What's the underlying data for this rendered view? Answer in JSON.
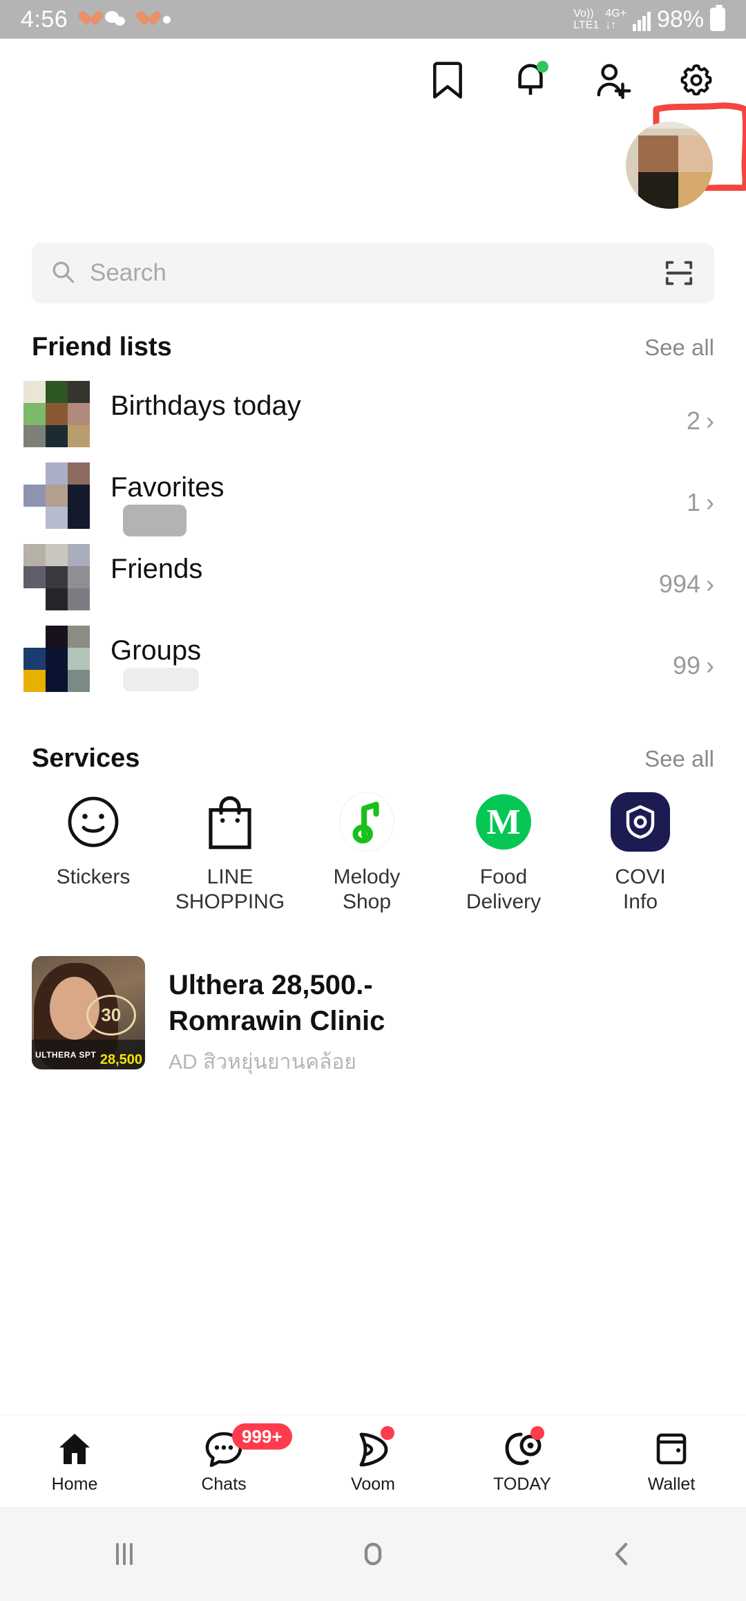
{
  "status_bar": {
    "time": "4:56",
    "icons": [
      "heart-icon",
      "wechat-icon",
      "heart-icon",
      "dot-icon"
    ],
    "volte": "Vo))",
    "network_label": "LTE1",
    "network_type": "4G+",
    "data_arrows": "↓↑",
    "battery_percent": "98%",
    "background": "#b4b4b4"
  },
  "header": {
    "icons": [
      {
        "name": "bookmark-icon",
        "label": "Keep"
      },
      {
        "name": "bell-icon",
        "label": "Notifications",
        "has_dot": true,
        "dot_color": "#30c45e"
      },
      {
        "name": "add-friend-icon",
        "label": "Add friends"
      },
      {
        "name": "gear-icon",
        "label": "Settings",
        "annotated": true
      }
    ],
    "annotation_color": "#f4453f"
  },
  "search": {
    "placeholder": "Search",
    "value": "",
    "scan_icon": "qr-scan-icon"
  },
  "friend_lists": {
    "title": "Friend lists",
    "see_all": "See all",
    "rows": [
      {
        "label": "Birthdays today",
        "count": "2",
        "chevron": "›"
      },
      {
        "label": "Favorites",
        "count": "1",
        "chevron": "›"
      },
      {
        "label": "Friends",
        "count": "994",
        "chevron": "›"
      },
      {
        "label": "Groups",
        "count": "99",
        "chevron": "›"
      }
    ]
  },
  "services": {
    "title": "Services",
    "see_all": "See all",
    "items": [
      {
        "label": "Stickers",
        "icon": "smiley-face-icon"
      },
      {
        "label": "LINE\nSHOPPING",
        "line1": "LINE",
        "line2": "SHOPPING",
        "icon": "shopping-bag-icon"
      },
      {
        "label": "Melody\nShop",
        "line1": "Melody",
        "line2": "Shop",
        "icon": "music-note-icon",
        "color": "#18c01c"
      },
      {
        "label": "Food\nDelivery",
        "line1": "Food",
        "line2": "Delivery",
        "icon": "food-delivery-m-icon",
        "color": "#06c755",
        "glyph": "M"
      },
      {
        "label": "COVID\nInfo",
        "line1": "COVI",
        "line2": "Info",
        "icon": "covid-shield-icon",
        "color": "#1c1c52"
      }
    ]
  },
  "ad": {
    "title_line1": "Ulthera  28,500.-",
    "title_line2": "Romrawin Clinic",
    "sub": "AD  สิวหยุ่นยานคล้อย",
    "thumb_brand": "ULTHERA SPT",
    "thumb_price": "28,500",
    "thumb_badge": "30"
  },
  "bottom_nav": {
    "items": [
      {
        "label": "Home",
        "icon": "home-icon",
        "active": true
      },
      {
        "label": "Chats",
        "icon": "chat-bubble-icon",
        "badge": "999+"
      },
      {
        "label": "Voom",
        "icon": "voom-play-icon",
        "dot": true
      },
      {
        "label": "TODAY",
        "icon": "today-icon",
        "dot": true
      },
      {
        "label": "Wallet",
        "icon": "wallet-icon"
      }
    ],
    "badge_color": "#ff3b4e"
  },
  "android_nav": {
    "items": [
      {
        "name": "recents-button",
        "glyph": "|||"
      },
      {
        "name": "home-button",
        "glyph": "▢"
      },
      {
        "name": "back-button",
        "glyph": "‹"
      }
    ]
  }
}
